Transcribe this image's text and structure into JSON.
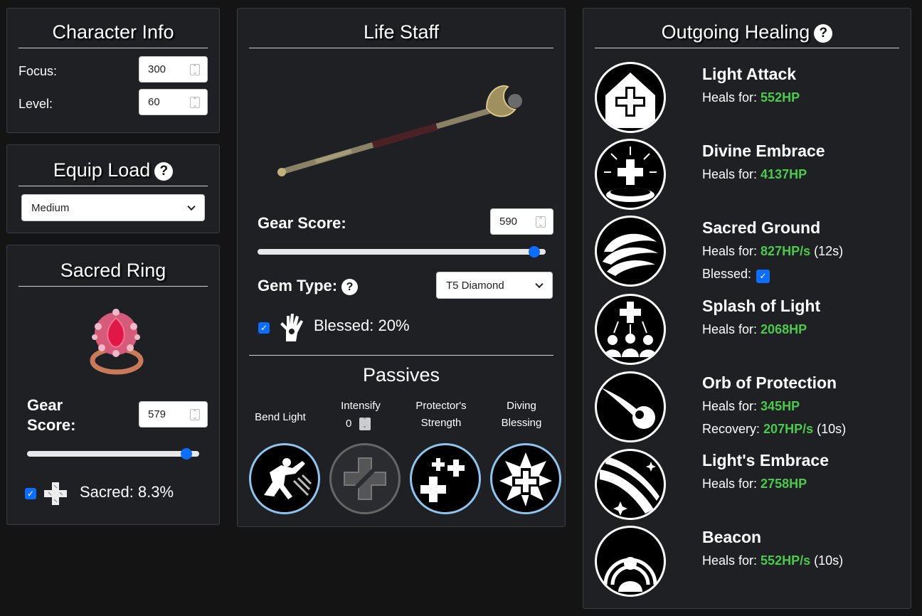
{
  "character_info": {
    "title": "Character Info",
    "focus_label": "Focus:",
    "focus_value": "300",
    "level_label": "Level:",
    "level_value": "60"
  },
  "equip_load": {
    "title": "Equip Load",
    "help": "?",
    "selected": "Medium"
  },
  "sacred_ring": {
    "title": "Sacred Ring",
    "gear_score_label_1": "Gear",
    "gear_score_label_2": "Score:",
    "gear_score_value": "579",
    "gear_score_slider": 0.96,
    "perk_label": "Sacred: 8.3%",
    "perk_checked": true
  },
  "life_staff": {
    "title": "Life Staff",
    "gear_score_label": "Gear Score:",
    "gear_score_value": "590",
    "gear_score_slider": 0.98,
    "gem_type_label": "Gem Type:",
    "gem_help": "?",
    "gem_selected": "T5 Diamond",
    "perk_label": "Blessed: 20%",
    "perk_checked": true,
    "passives_title": "Passives",
    "passives": [
      {
        "label": "Bend Light",
        "active": true,
        "icon": "bend-light-icon"
      },
      {
        "label": "Intensify",
        "stepper": "0",
        "active": false,
        "icon": "intensify-icon"
      },
      {
        "label_1": "Protector's",
        "label_2": "Strength",
        "active": true,
        "icon": "protectors-strength-icon"
      },
      {
        "label_1": "Diving",
        "label_2": "Blessing",
        "active": true,
        "icon": "divine-blessing-icon"
      }
    ]
  },
  "outgoing_healing": {
    "title": "Outgoing Healing",
    "help": "?",
    "heals_for_label": "Heals for:",
    "abilities": [
      {
        "name": "Light Attack",
        "value": "552HP",
        "icon": "light-attack-icon"
      },
      {
        "name": "Divine Embrace",
        "value": "4137HP",
        "icon": "divine-embrace-icon"
      },
      {
        "name": "Sacred Ground",
        "value": "827HP/s",
        "extra": "(12s)",
        "blessed_label": "Blessed:",
        "blessed_checked": true,
        "icon": "sacred-ground-icon"
      },
      {
        "name": "Splash of Light",
        "value": "2068HP",
        "icon": "splash-of-light-icon"
      },
      {
        "name": "Orb of Protection",
        "value": "345HP",
        "recovery_label": "Recovery:",
        "recovery_value": "207HP/s",
        "recovery_extra": "(10s)",
        "icon": "orb-of-protection-icon"
      },
      {
        "name": "Light's Embrace",
        "value": "2758HP",
        "icon": "lights-embrace-icon"
      },
      {
        "name": "Beacon",
        "value": "552HP/s",
        "extra": "(10s)",
        "icon": "beacon-icon"
      }
    ]
  },
  "colors": {
    "panel_bg": "#1e2024",
    "accent": "#0d6efd",
    "heal_green": "#4cc94c",
    "passive_ring": "#8ec4ee"
  }
}
